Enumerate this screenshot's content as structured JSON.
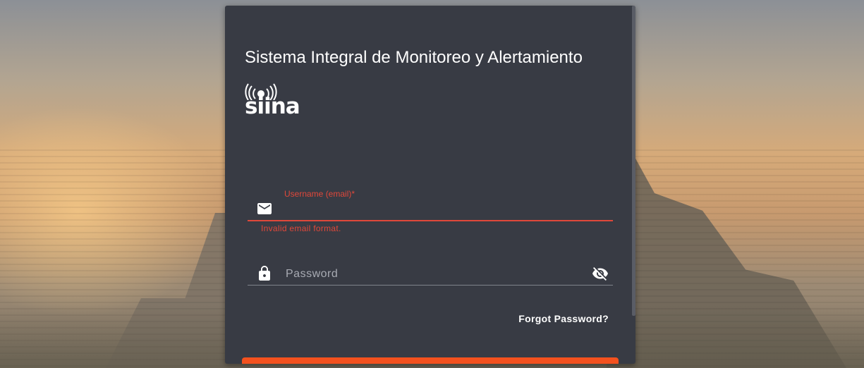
{
  "app": {
    "title": "Sistema Integral de Monitoreo y Alertamiento",
    "logo_text": "siina"
  },
  "form": {
    "email": {
      "label": "Username (email)*",
      "value": "",
      "error": "Invalid email format."
    },
    "password": {
      "placeholder": "Password",
      "value": ""
    },
    "forgot_label": "Forgot Password?",
    "submit_label": ""
  },
  "icons": {
    "logo_signal": "broadcast-icon",
    "email": "mail-icon",
    "password": "lock-icon",
    "visibility": "eye-off-icon"
  },
  "colors": {
    "card_bg": "#383b44",
    "error": "#e0483a",
    "accent": "#f4511e",
    "text": "#ffffff"
  }
}
